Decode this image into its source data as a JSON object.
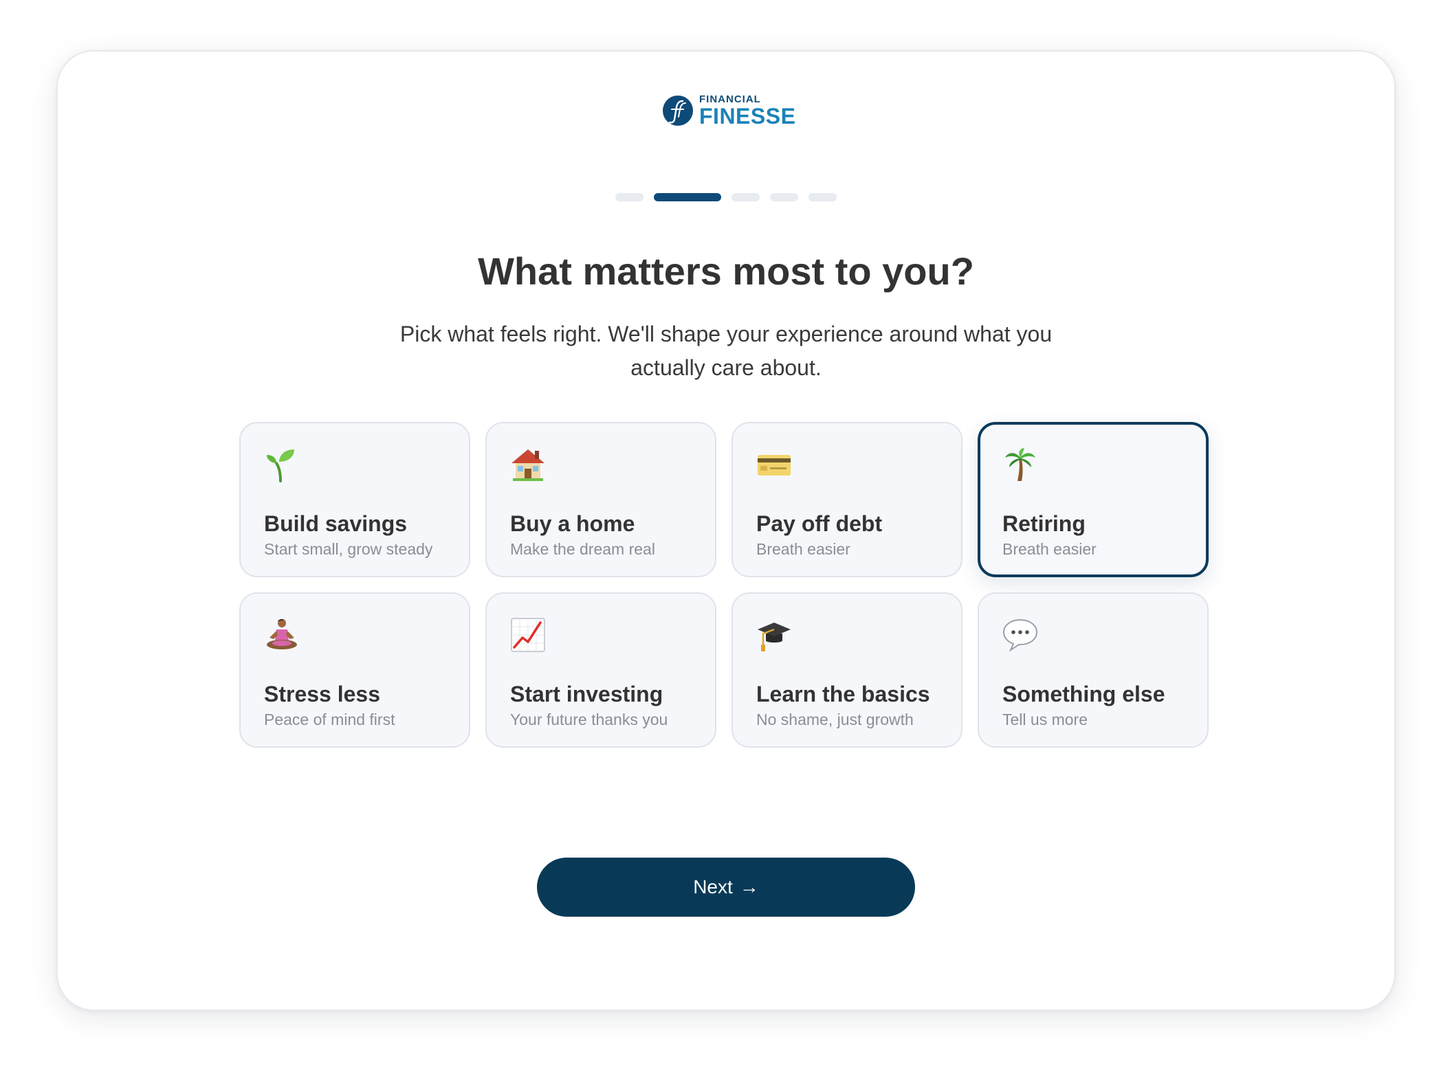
{
  "brand": {
    "small_text": "FINANCIAL",
    "big_text": "FINESSE",
    "primary_color": "#0e4a78",
    "accent_color": "#1b82b8"
  },
  "progress": {
    "total_steps": 5,
    "current_step": 2
  },
  "header": {
    "title": "What matters most to you?",
    "subtitle": "Pick what feels right. We'll shape your experience around what you actually care about."
  },
  "options": [
    {
      "icon": "seedling-icon",
      "title": "Build savings",
      "subtitle": "Start small, grow steady",
      "selected": false
    },
    {
      "icon": "house-icon",
      "title": "Buy a home",
      "subtitle": "Make the dream real",
      "selected": false
    },
    {
      "icon": "credit-card-icon",
      "title": "Pay off debt",
      "subtitle": "Breath easier",
      "selected": false
    },
    {
      "icon": "palm-tree-icon",
      "title": "Retiring",
      "subtitle": "Breath easier",
      "selected": true
    },
    {
      "icon": "meditation-icon",
      "title": "Stress less",
      "subtitle": "Peace of mind first",
      "selected": false
    },
    {
      "icon": "chart-increasing-icon",
      "title": "Start investing",
      "subtitle": "Your future thanks you",
      "selected": false
    },
    {
      "icon": "graduation-cap-icon",
      "title": "Learn the basics",
      "subtitle": "No shame, just growth",
      "selected": false
    },
    {
      "icon": "speech-bubble-icon",
      "title": "Something else",
      "subtitle": "Tell us more",
      "selected": false
    }
  ],
  "actions": {
    "next_label": "Next",
    "next_arrow": "→",
    "button_color": "#083a57"
  }
}
